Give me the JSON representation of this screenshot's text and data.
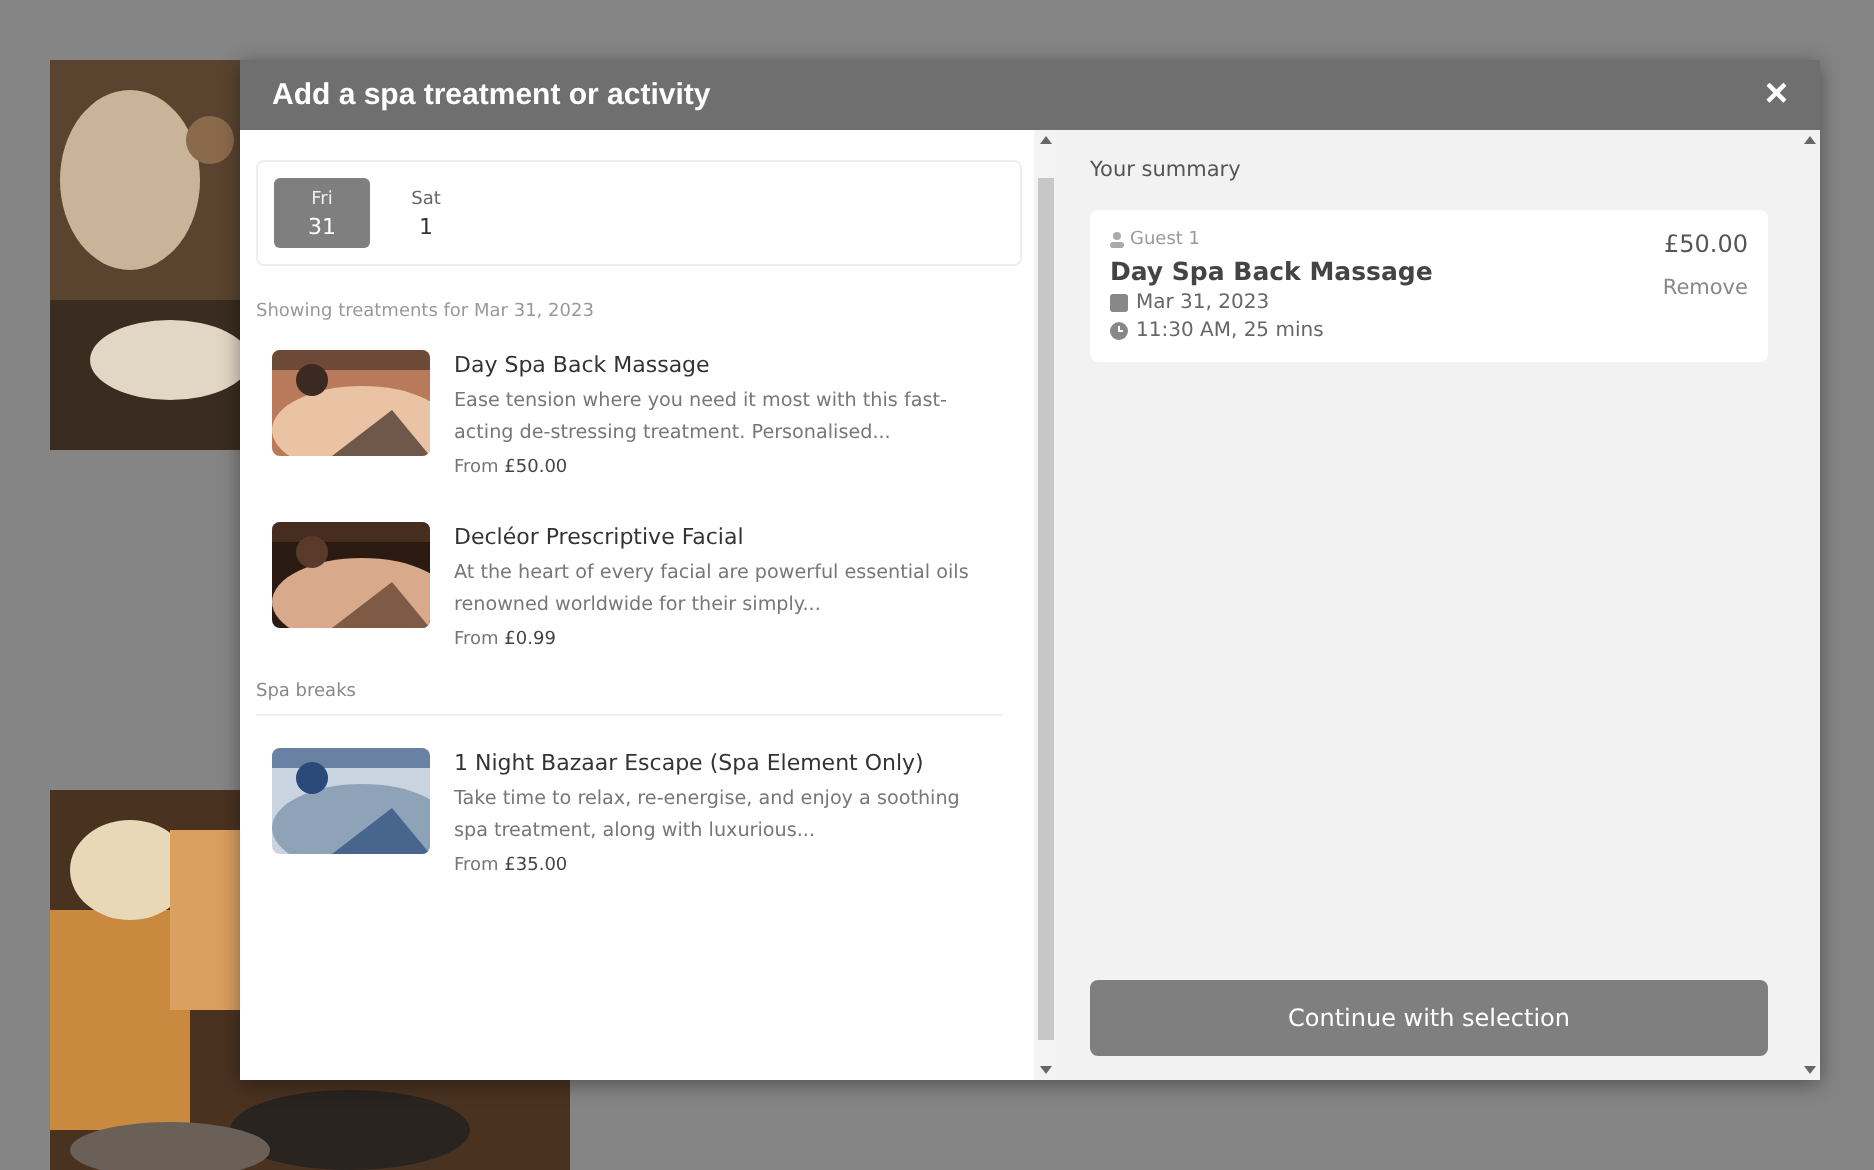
{
  "dialog": {
    "title": "Add a spa treatment or activity",
    "close": "×"
  },
  "dates": [
    {
      "day": "Fri",
      "date": "31",
      "selected": true
    },
    {
      "day": "Sat",
      "date": "1",
      "selected": false
    }
  ],
  "showing": "Showing treatments for Mar 31, 2023",
  "sections": [
    {
      "items": [
        {
          "name": "Day Spa Back Massage",
          "description": "Ease tension where you need it most with this fast-acting de-stressing treatment. Personalised...",
          "price": "From **£50.00**",
          "kind": "massage"
        },
        {
          "name": "Decléor Prescriptive Facial",
          "description": "At the heart of every facial are powerful essential oils renowned worldwide for their simply...",
          "price": "From **£0.99**",
          "kind": "facial"
        }
      ]
    },
    {
      "title": "Spa breaks",
      "items": [
        {
          "name": "1 Night Bazaar Escape (Spa Element Only)",
          "description": "Take time to relax, re-energise, and enjoy a soothing spa treatment, along with luxurious...",
          "price": "From **£35.00**",
          "kind": "pool"
        }
      ]
    }
  ],
  "summary": {
    "title": "Your summary",
    "guest": "Guest 1",
    "price": "£50.00",
    "remove": "Remove",
    "treatment": "Day Spa Back Massage",
    "date": "Mar 31, 2023",
    "time": "11:30 AM, 25 mins"
  },
  "continue": "Continue with selection"
}
